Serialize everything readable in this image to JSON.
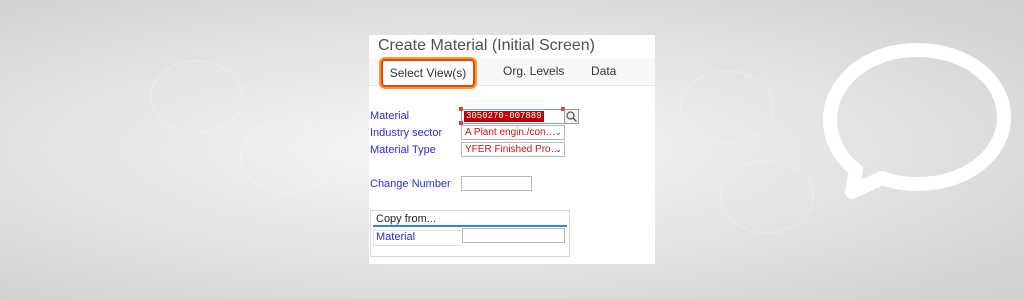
{
  "screen": {
    "title": "Create Material (Initial Screen)"
  },
  "tabs": [
    {
      "label": "Select View(s)",
      "active": true
    },
    {
      "label": "Org. Levels",
      "active": false
    },
    {
      "label": "Data",
      "active": false
    }
  ],
  "form": {
    "material_label": "Material",
    "material_value": "3050270-007889",
    "industry_sector_label": "Industry sector",
    "industry_sector_value": "A Plant engin./con…",
    "material_type_label": "Material Type",
    "material_type_value": "YFER Finished Pro…",
    "change_number_label": "Change Number",
    "change_number_value": ""
  },
  "copy_from": {
    "title": "Copy from...",
    "material_label": "Material",
    "material_value": ""
  },
  "icons": {
    "search": "search-icon",
    "dropdown": "chevron-down-icon",
    "chat": "chat-bubble-icon"
  },
  "colors": {
    "label_blue": "#2c2ccf",
    "value_red": "#cc1111",
    "highlight_red": "#c00000",
    "active_tab_border": "#e8421f",
    "active_tab_glow": "#f4a21b",
    "section_line": "#2a8bd0"
  }
}
